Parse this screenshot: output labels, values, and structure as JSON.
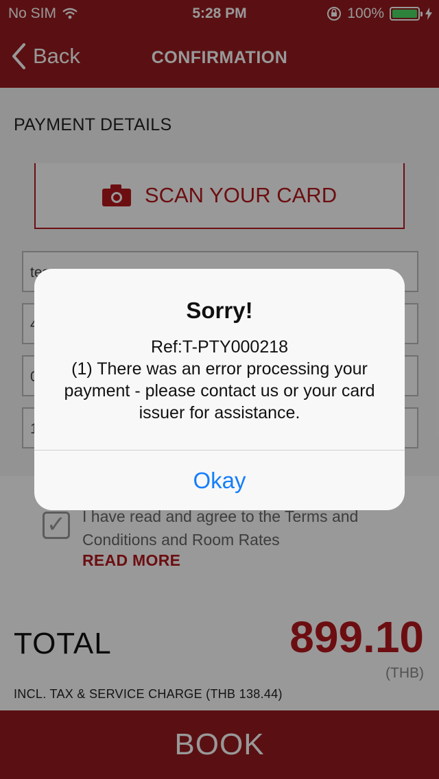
{
  "status_bar": {
    "carrier": "No SIM",
    "time": "5:28 PM",
    "battery": "100%"
  },
  "nav": {
    "back_label": "Back",
    "title": "CONFIRMATION"
  },
  "payment": {
    "section_title": "PAYMENT DETAILS",
    "scan_label": "SCAN YOUR CARD",
    "fields": [
      "tes",
      "4",
      "0",
      "1"
    ]
  },
  "terms": {
    "text": "I have read and agree to the Terms and Conditions and Room Rates",
    "read_more": "READ MORE"
  },
  "total": {
    "label": "TOTAL",
    "amount": "899.10",
    "currency": "(THB)",
    "note": "INCL. TAX & SERVICE CHARGE (THB  138.44)"
  },
  "book_label": "BOOK",
  "alert": {
    "title": "Sorry!",
    "message": "Ref:T-PTY000218\n(1) There was an error processing your payment - please contact us or your card issuer for assistance.",
    "button": "Okay"
  },
  "colors": {
    "brand": "#961b1e",
    "accent": "#b5181d",
    "ios_blue": "#147efb",
    "battery_green": "#4cd964"
  }
}
